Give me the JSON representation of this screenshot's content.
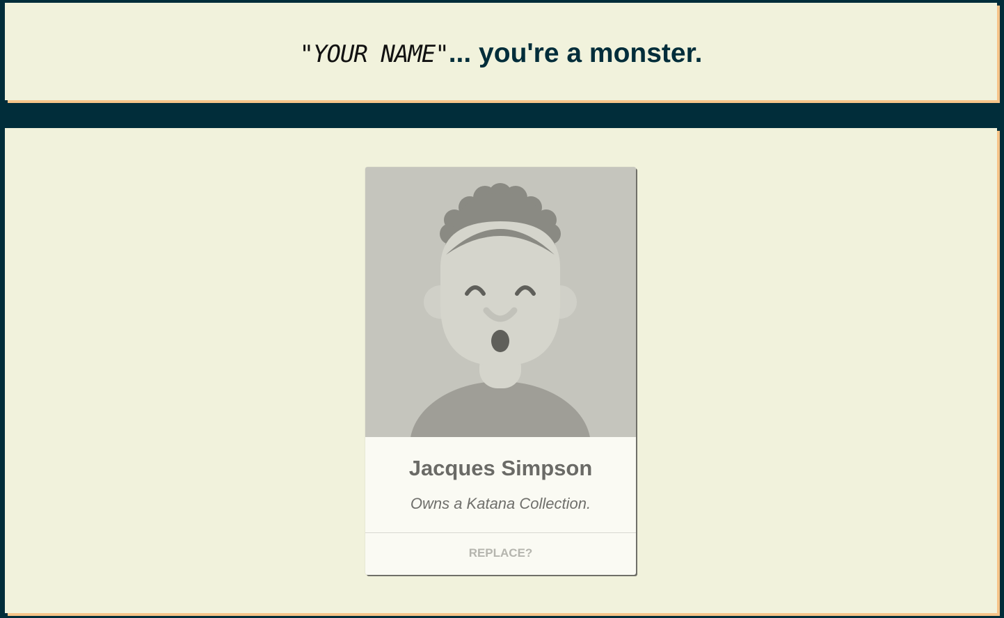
{
  "header": {
    "name_placeholder": "\"YOUR NAME\"",
    "title_suffix": "... you're a monster."
  },
  "card": {
    "avatar_icon": "avatar-illustration",
    "name": "Jacques Simpson",
    "description": "Owns a Katana Collection.",
    "replace_label": "REPLACE?"
  },
  "colors": {
    "background": "#012d3a",
    "panel": "#f1f2dc",
    "panel_shadow": "#f6c489",
    "card": "#fafaf3",
    "text_dark": "#012d3a"
  }
}
